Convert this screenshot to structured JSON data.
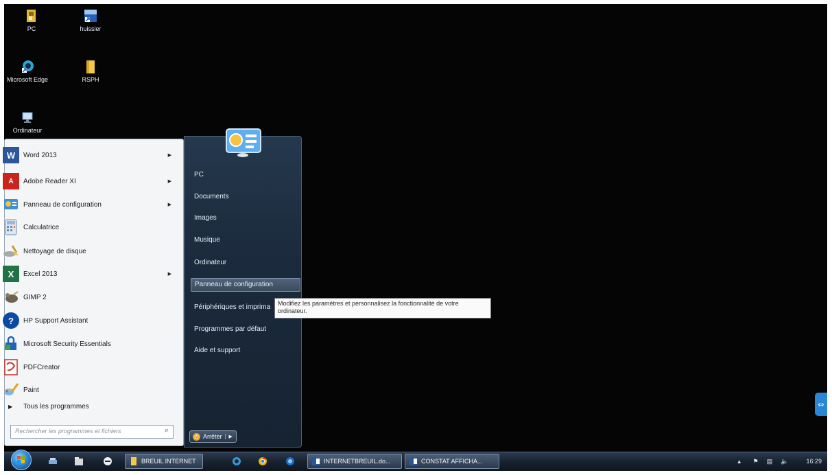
{
  "desktop": {
    "icons": [
      {
        "label": "PC",
        "icon": "folder-user-icon"
      },
      {
        "label": "huissier",
        "icon": "shortcut-icon"
      },
      {
        "label": "Microsoft Edge",
        "icon": "edge-icon"
      },
      {
        "label": "RSPH",
        "icon": "folder-icon"
      },
      {
        "label": "Ordinateur",
        "icon": "computer-icon"
      }
    ]
  },
  "start_menu": {
    "programs": [
      {
        "label": "Word 2013",
        "icon": "word-icon",
        "color": "#2b579a",
        "has_submenu": true
      },
      {
        "label": "Adobe Reader XI",
        "icon": "adobe-reader-icon",
        "color": "#c8261c",
        "has_submenu": true
      },
      {
        "label": "Panneau de configuration",
        "icon": "control-panel-icon",
        "color": "#3f8fd6",
        "has_submenu": true
      },
      {
        "label": "Calculatrice",
        "icon": "calculator-icon",
        "color": "#6d8fb5",
        "has_submenu": false
      },
      {
        "label": "Nettoyage de disque",
        "icon": "disk-cleanup-icon",
        "color": "#8c8c8c",
        "has_submenu": false
      },
      {
        "label": "Excel 2013",
        "icon": "excel-icon",
        "color": "#217346",
        "has_submenu": true
      },
      {
        "label": "GIMP 2",
        "icon": "gimp-icon",
        "color": "#6e6250",
        "has_submenu": false
      },
      {
        "label": "HP Support Assistant",
        "icon": "hp-support-icon",
        "color": "#0a4aa3",
        "has_submenu": false
      },
      {
        "label": "Microsoft Security Essentials",
        "icon": "security-essentials-icon",
        "color": "#2063b8",
        "has_submenu": false
      },
      {
        "label": "PDFCreator",
        "icon": "pdfcreator-icon",
        "color": "#c2352a",
        "has_submenu": false
      },
      {
        "label": "Paint",
        "icon": "paint-icon",
        "color": "#e8a020",
        "has_submenu": false
      }
    ],
    "all_programs_label": "Tous les programmes",
    "search_placeholder": "Rechercher les programmes et fichiers",
    "right_items": [
      {
        "label": "PC",
        "highlighted": false
      },
      {
        "label": "Documents",
        "highlighted": false
      },
      {
        "label": "Images",
        "highlighted": false
      },
      {
        "label": "Musique",
        "highlighted": false
      },
      {
        "label": "Ordinateur",
        "highlighted": false
      },
      {
        "label": "Panneau de configuration",
        "highlighted": true
      },
      {
        "label": "Périphériques et imprima",
        "highlighted": false
      },
      {
        "label": "Programmes par défaut",
        "highlighted": false
      },
      {
        "label": "Aide et support",
        "highlighted": false
      }
    ],
    "shutdown_label": "Arrêter",
    "tooltip": "Modifiez les paramètres et personnalisez la fonctionnalité de votre ordinateur."
  },
  "taskbar": {
    "buttons": [
      {
        "label": "BREUIL INTERNET",
        "icon": "folder-icon"
      },
      {
        "label": "INTERNETBREUIL.do...",
        "icon": "word-doc-icon"
      },
      {
        "label": "CONSTAT AFFICHA...",
        "icon": "word-doc-icon"
      }
    ],
    "clock": "16:29"
  }
}
